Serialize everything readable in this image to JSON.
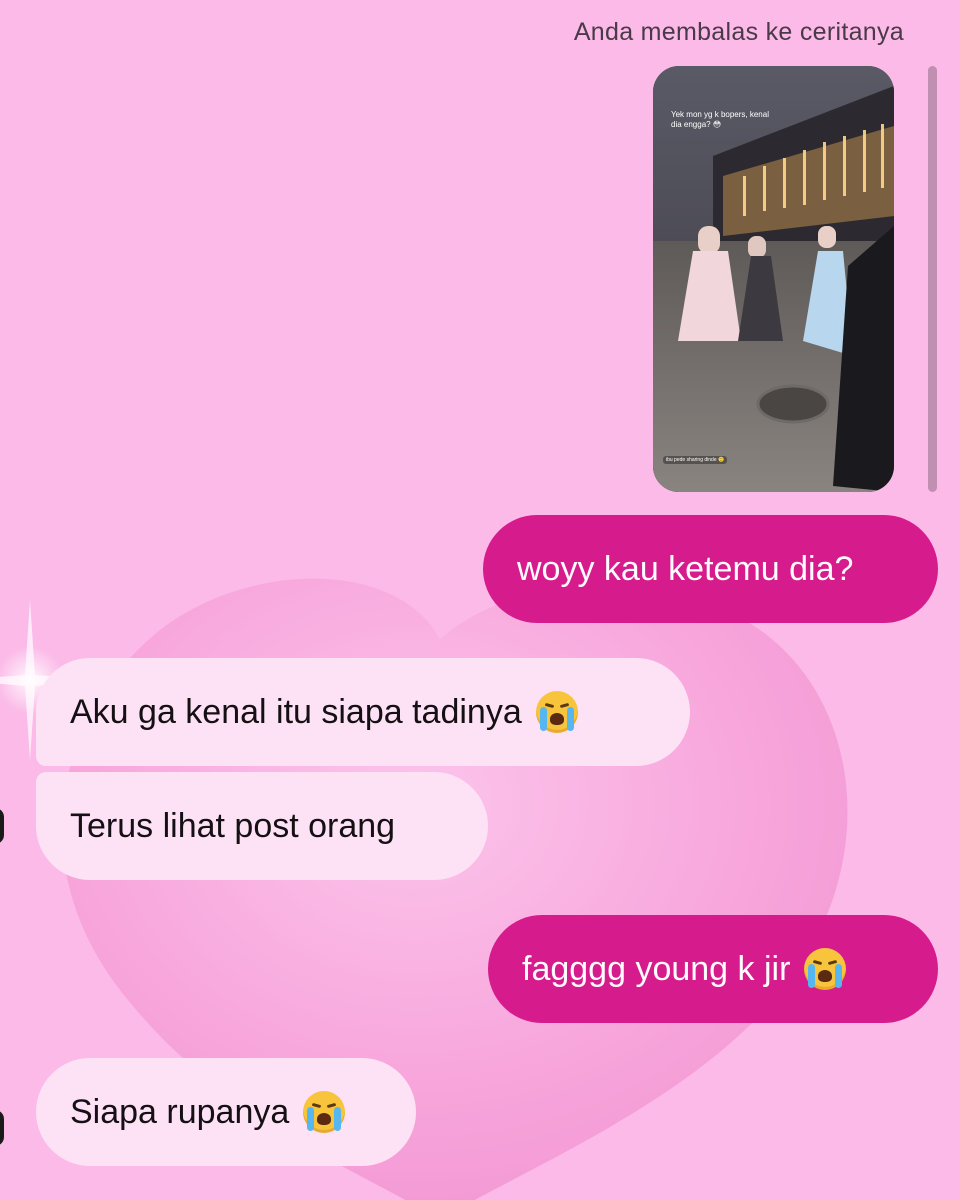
{
  "reply_header": "Anda membalas ke ceritanya",
  "story": {
    "caption": "Yek mon yg k bopers, kenal dia engga? 😳",
    "footer": "ibu pede sharing dinde 🙂"
  },
  "messages": [
    {
      "direction": "outgoing",
      "text": "woyy kau ketemu dia?",
      "emoji": null
    },
    {
      "direction": "incoming",
      "text": "Aku ga kenal itu siapa tadinya",
      "emoji": "loudly-crying-face"
    },
    {
      "direction": "incoming",
      "text": "Terus lihat post orang",
      "emoji": null
    },
    {
      "direction": "outgoing",
      "text": "fagggg young k jir",
      "emoji": "loudly-crying-face"
    },
    {
      "direction": "incoming",
      "text": "Siapa rupanya",
      "emoji": "loudly-crying-face"
    }
  ],
  "colors": {
    "background": "#fbbae8",
    "outgoing_bubble": "#d61c8c",
    "incoming_bubble": "#fde2f6",
    "heart": "#f7a0d8"
  }
}
